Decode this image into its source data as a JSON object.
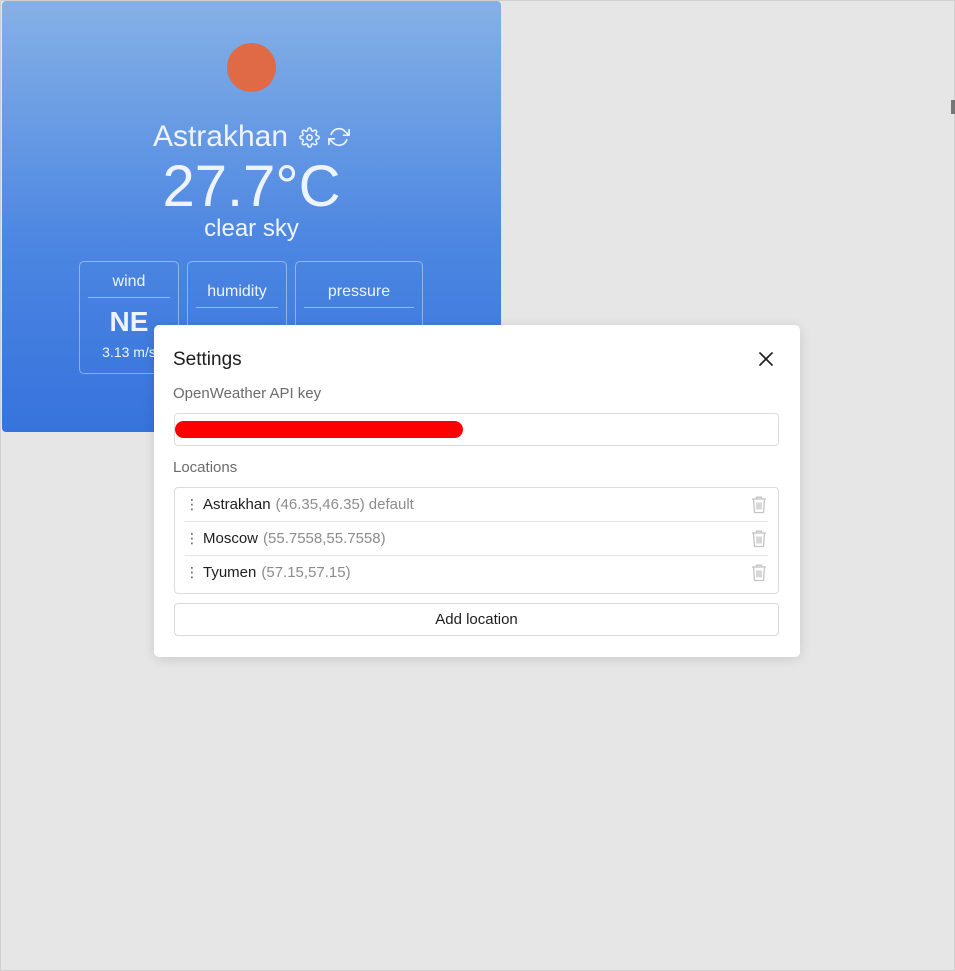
{
  "weather": {
    "city": "Astrakhan",
    "temperature": "27.7°C",
    "description": "clear sky",
    "sun_color": "#df6a45",
    "metrics": [
      {
        "title": "wind",
        "value": "NE",
        "sub": "3.13 m/s"
      },
      {
        "title": "humidity",
        "value": "",
        "sub": ""
      },
      {
        "title": "pressure",
        "value": "",
        "sub": ""
      }
    ],
    "icons": {
      "settings": "gear-icon",
      "refresh": "refresh-icon"
    }
  },
  "settings": {
    "title": "Settings",
    "api_key_label": "OpenWeather API key",
    "api_key_value": "",
    "locations_label": "Locations",
    "locations": [
      {
        "name": "Astrakhan",
        "coords": "(46.35,46.35)",
        "tag": "default"
      },
      {
        "name": "Moscow",
        "coords": "(55.7558,55.7558)",
        "tag": ""
      },
      {
        "name": "Tyumen",
        "coords": "(57.15,57.15)",
        "tag": ""
      }
    ],
    "add_location_label": "Add location"
  }
}
